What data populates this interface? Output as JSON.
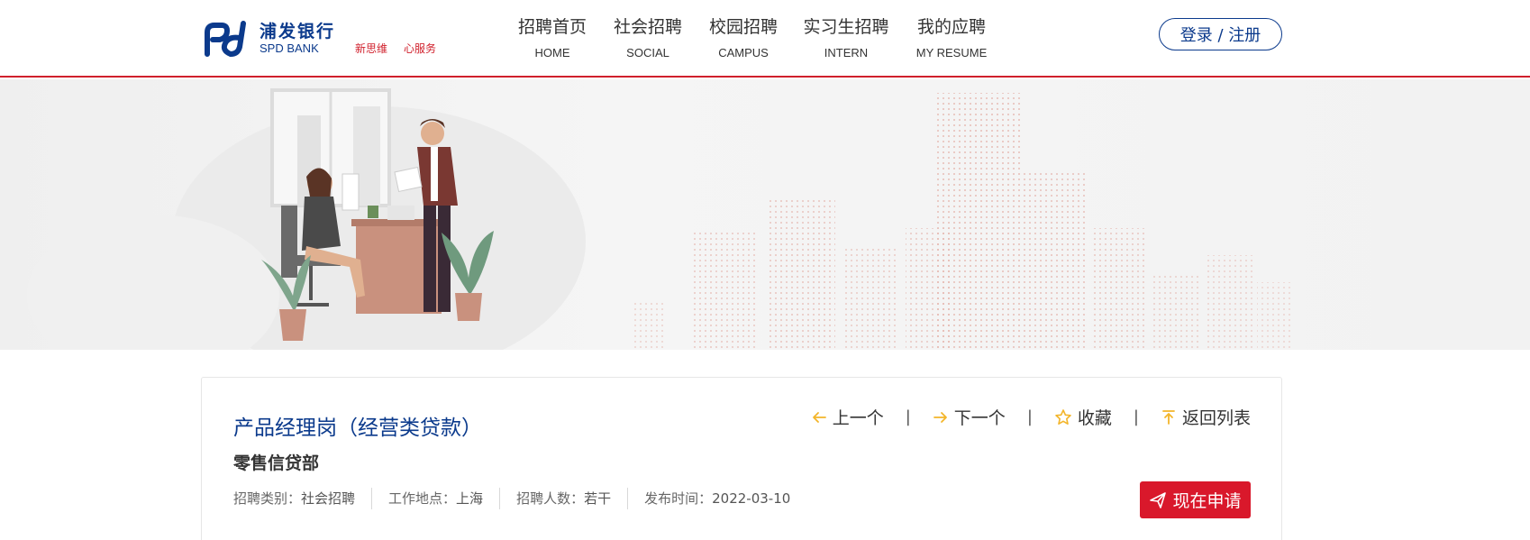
{
  "brand": {
    "name_cn": "浦发银行",
    "name_en": "SPD BANK",
    "slogan": [
      "新思维",
      "心服务"
    ],
    "primary_color": "#0b3a8c",
    "accent_color": "#d0202c"
  },
  "nav": {
    "items": [
      {
        "cn": "招聘首页",
        "en": "HOME"
      },
      {
        "cn": "社会招聘",
        "en": "SOCIAL"
      },
      {
        "cn": "校园招聘",
        "en": "CAMPUS"
      },
      {
        "cn": "实习生招聘",
        "en": "INTERN"
      },
      {
        "cn": "我的应聘",
        "en": "MY RESUME"
      }
    ],
    "login_label": "登录 / 注册"
  },
  "job": {
    "title": "产品经理岗（经营类贷款）",
    "department": "零售信贷部",
    "meta": {
      "category_label": "招聘类别：",
      "category_value": "社会招聘",
      "location_label": "工作地点：",
      "location_value": "上海",
      "headcount_label": "招聘人数：",
      "headcount_value": "若干",
      "publish_label": "发布时间：",
      "publish_value": "2022-03-10"
    },
    "actions": {
      "prev": "上一个",
      "next": "下一个",
      "favorite": "收藏",
      "back": "返回列表"
    },
    "apply_label": "现在申请"
  },
  "icons": {
    "prev": "arrow-left-icon",
    "next": "arrow-right-icon",
    "favorite": "star-icon",
    "back": "arrow-up-icon",
    "apply": "paper-plane-icon"
  }
}
